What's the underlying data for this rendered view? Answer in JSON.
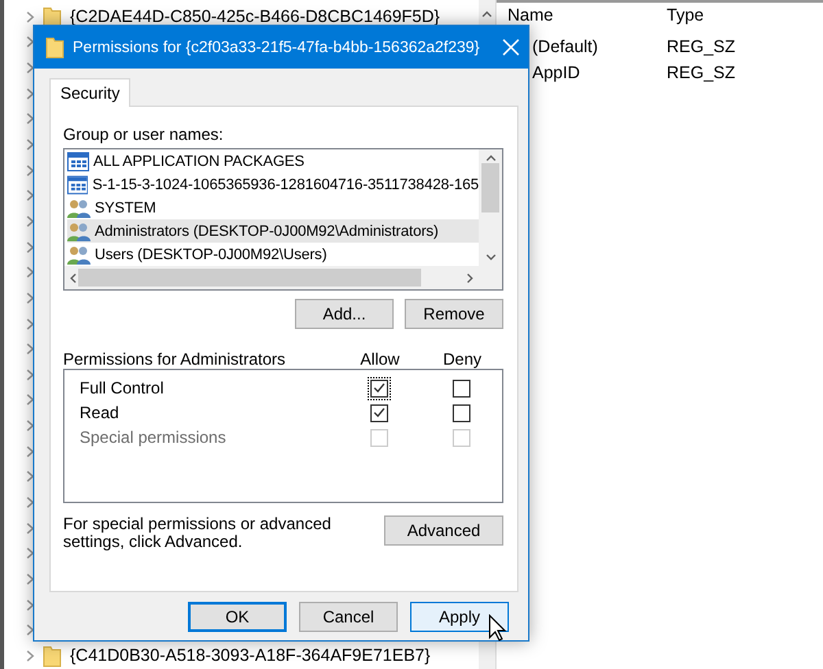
{
  "registry": {
    "tree_items": [
      {
        "label": "{C2DAE44D-C850-425c-B466-D8CBC1469F5D}"
      },
      {
        "label": "{C41D0B30-A518-3093-A18F-364AF9E71EB7}"
      }
    ],
    "columns": [
      "Name",
      "Type"
    ],
    "values": [
      {
        "name": "(Default)",
        "type": "REG_SZ"
      },
      {
        "name": "AppID",
        "type": "REG_SZ"
      }
    ]
  },
  "dialog": {
    "title": "Permissions for {c2f03a33-21f5-47fa-b4bb-156362a2f239}",
    "tabs": [
      {
        "label": "Security",
        "selected": true
      }
    ],
    "group_label": "Group or user names:",
    "principals": [
      {
        "name": "ALL APPLICATION PACKAGES",
        "kind": "package",
        "selected": false
      },
      {
        "name": "S-1-15-3-1024-1065365936-1281604716-3511738428-165",
        "kind": "package",
        "selected": false
      },
      {
        "name": "SYSTEM",
        "kind": "group",
        "selected": false
      },
      {
        "name": "Administrators (DESKTOP-0J00M92\\Administrators)",
        "kind": "group",
        "selected": true
      },
      {
        "name": "Users (DESKTOP-0J00M92\\Users)",
        "kind": "group",
        "selected": false
      }
    ],
    "principal_buttons": [
      "Add...",
      "Remove"
    ],
    "permissions_label": "Permissions for Administrators",
    "permission_columns": [
      "Allow",
      "Deny"
    ],
    "permissions": [
      {
        "name": "Full Control",
        "allow": true,
        "deny": false,
        "disabled": false,
        "focused": true
      },
      {
        "name": "Read",
        "allow": true,
        "deny": false,
        "disabled": false,
        "focused": false
      },
      {
        "name": "Special permissions",
        "allow": false,
        "deny": false,
        "disabled": true,
        "focused": false
      }
    ],
    "advanced_note": "For special permissions or advanced settings, click Advanced.",
    "advanced_button": "Advanced",
    "buttons": [
      {
        "label": "OK",
        "default": true,
        "hovered": false
      },
      {
        "label": "Cancel",
        "default": false,
        "hovered": false
      },
      {
        "label": "Apply",
        "default": false,
        "hovered": true
      }
    ]
  }
}
